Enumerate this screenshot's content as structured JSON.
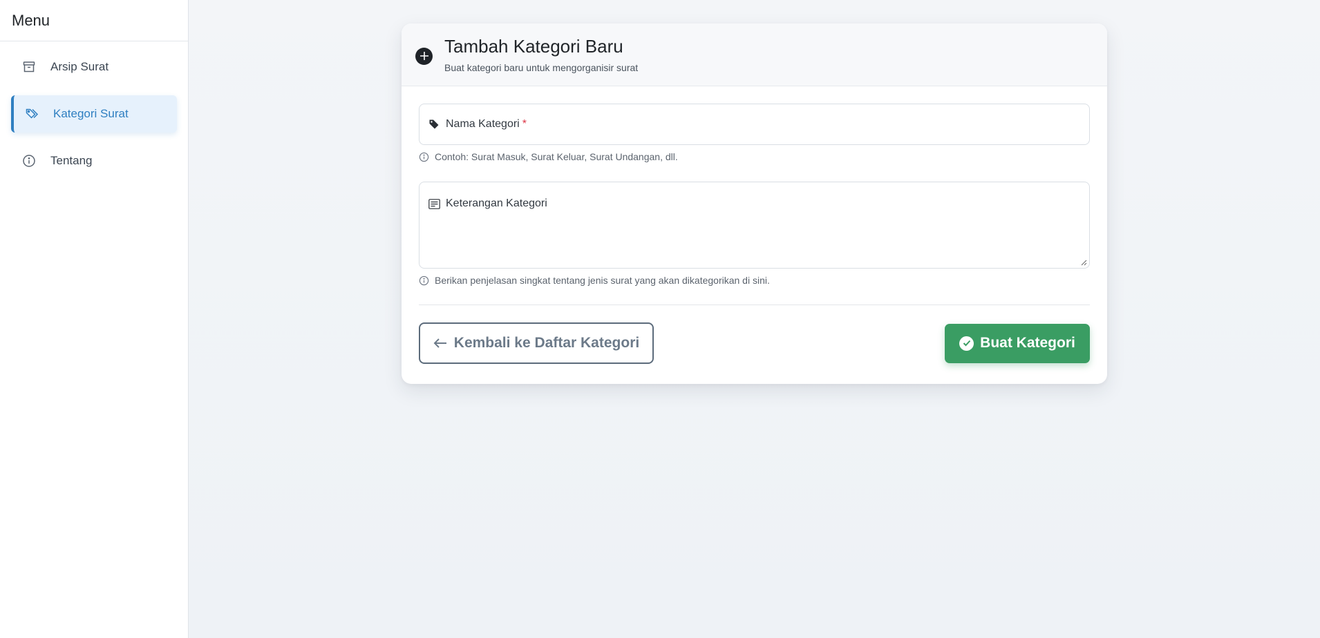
{
  "sidebar": {
    "title": "Menu",
    "items": [
      {
        "label": "Arsip Surat",
        "icon": "archive-icon",
        "active": false
      },
      {
        "label": "Kategori Surat",
        "icon": "tags-icon",
        "active": true
      },
      {
        "label": "Tentang",
        "icon": "info-icon",
        "active": false
      }
    ]
  },
  "form": {
    "title": "Tambah Kategori Baru",
    "subtitle": "Buat kategori baru untuk mengorganisir surat",
    "name_field": {
      "label": "Nama Kategori",
      "required_mark": "*",
      "value": ""
    },
    "name_hint": "Contoh: Surat Masuk, Surat Keluar, Surat Undangan, dll.",
    "description_field": {
      "label": "Keterangan Kategori",
      "value": ""
    },
    "description_hint": "Berikan penjelasan singkat tentang jenis surat yang akan dikategorikan di sini.",
    "back_button": "Kembali ke Daftar Kategori",
    "submit_button": "Buat Kategori"
  },
  "colors": {
    "accent": "#2f7fc1",
    "success": "#3a9d63",
    "required": "#dc3545"
  }
}
